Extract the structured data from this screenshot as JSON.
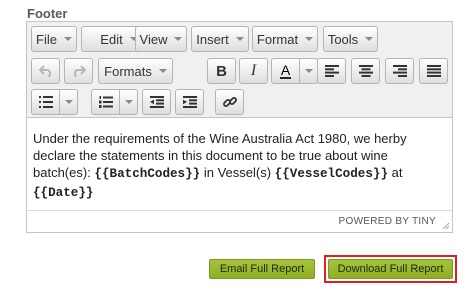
{
  "section": {
    "label": "Footer"
  },
  "menubar": {
    "items": [
      {
        "label": "File"
      },
      {
        "label": "Edit"
      },
      {
        "label": "View"
      },
      {
        "label": "Insert"
      },
      {
        "label": "Format"
      },
      {
        "label": "Tools"
      }
    ]
  },
  "toolbar": {
    "formats_label": "Formats",
    "bold_label": "B",
    "italic_label": "I",
    "font_color_label": "A",
    "icons": {
      "undo": "undo-icon",
      "redo": "redo-icon",
      "align_left": "align-left-icon",
      "align_center": "align-center-icon",
      "align_right": "align-right-icon",
      "align_justify": "align-justify-icon",
      "bullet_list": "bullet-list-icon",
      "numbered_list": "numbered-list-icon",
      "outdent": "outdent-icon",
      "indent": "indent-icon",
      "link": "link-icon"
    }
  },
  "content": {
    "text_1": "Under the requirements of the Wine Australia Act 1980, we herby declare the statements in this document to be true about wine batch(es): ",
    "placeholder_batch": "{{BatchCodes}}",
    "text_2": " in Vessel(s) ",
    "placeholder_vessel": "{{VesselCodes}}",
    "text_3": " at ",
    "placeholder_date": "{{Date}}"
  },
  "statusbar": {
    "powered_by": "POWERED BY TINY"
  },
  "actions": {
    "email_label": "Email Full Report",
    "download_label": "Download Full Report"
  },
  "colors": {
    "action_button": "#9bbb32",
    "highlight_border": "#e02020"
  }
}
